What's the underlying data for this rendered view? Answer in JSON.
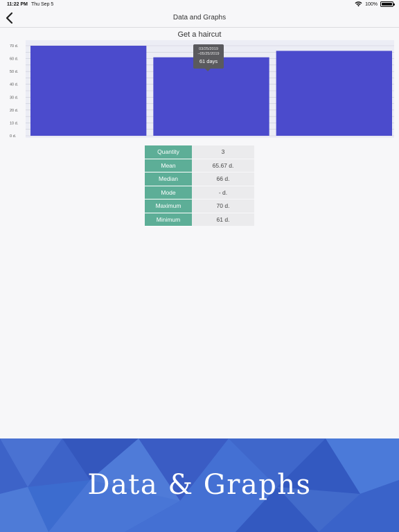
{
  "status_bar": {
    "time": "11:22 PM",
    "date": "Thu Sep 5",
    "battery": "100%"
  },
  "nav": {
    "title": "Data and Graphs"
  },
  "chart_data": {
    "type": "bar",
    "title": "Get a haircut",
    "categories": [
      "",
      "",
      ""
    ],
    "values": [
      70,
      61,
      66
    ],
    "ylim": [
      0,
      70
    ],
    "y_ticks": [
      "0 d.",
      "10 d.",
      "20 d.",
      "30 d.",
      "40 d.",
      "50 d.",
      "60 d.",
      "70 d."
    ],
    "grid": true,
    "bar_color": "#4b4bcc",
    "tooltip": {
      "line1": "03/25/2019",
      "line2": "–05/25/2019",
      "value": "61 days"
    }
  },
  "stats": [
    {
      "label": "Quantity",
      "value": "3"
    },
    {
      "label": "Mean",
      "value": "65.67 d."
    },
    {
      "label": "Median",
      "value": "66 d."
    },
    {
      "label": "Mode",
      "value": "- d."
    },
    {
      "label": "Maximum",
      "value": "70 d."
    },
    {
      "label": "Minimum",
      "value": "61 d."
    }
  ],
  "banner": {
    "title": "Data & Graphs"
  },
  "colors": {
    "accent_green": "#5dae97",
    "bar_blue": "#4b4bcc",
    "banner_blue": "#3d63c8"
  }
}
